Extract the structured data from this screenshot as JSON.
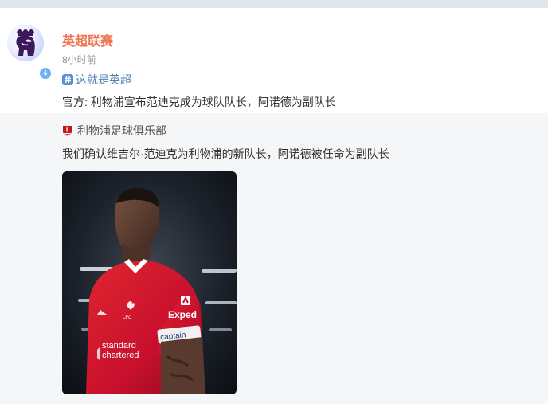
{
  "post": {
    "author": "英超联赛",
    "time": "8小时前",
    "topic": "这就是英超",
    "text": "官方: 利物浦宣布范迪克成为球队队长，阿诺德为副队长",
    "avatar_icon": "premier-league-lion-icon",
    "verified_icon": "lightning-verified-icon",
    "topic_icon": "hashtag-icon"
  },
  "repost": {
    "source": "利物浦足球俱乐部",
    "source_icon": "liverpool-crest-icon",
    "text": "我们确认维吉尔·范迪克为利物浦的新队长，阿诺德被任命为副队长",
    "image": {
      "sponsor": "Expedia",
      "sponsor_short": "Exped",
      "brand": "standard chartered",
      "armband": "captain",
      "club": "LFC"
    }
  },
  "colors": {
    "author": "#eb7350",
    "link": "#507daf",
    "repost_bg": "#f5f6f8",
    "kit_red": "#c8102e"
  }
}
